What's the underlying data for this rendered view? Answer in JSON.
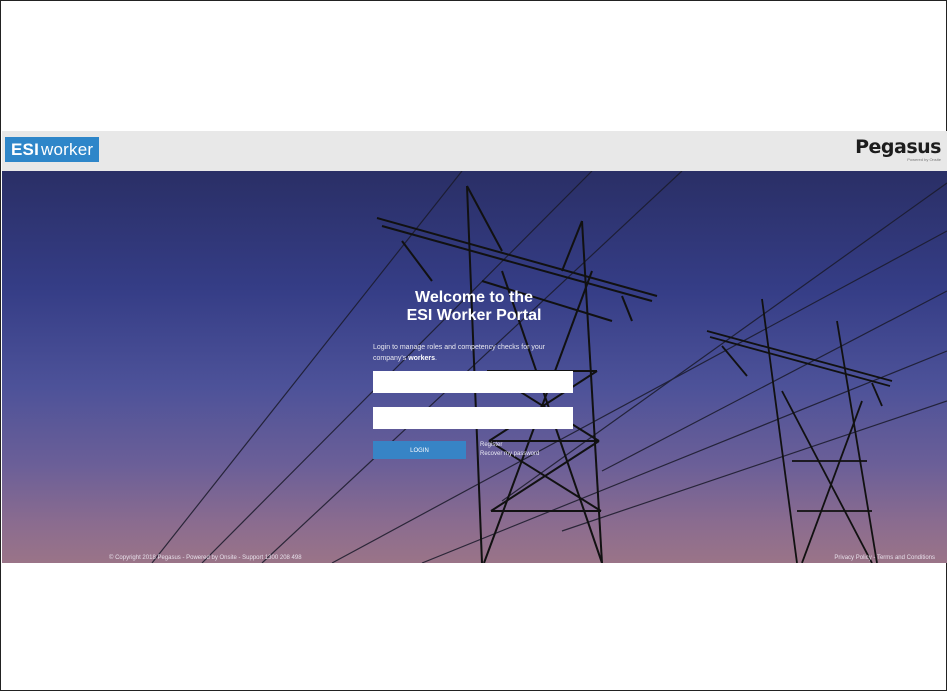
{
  "header": {
    "brand_bold": "ESI",
    "brand_light": "worker",
    "partner_name": "Pegasus",
    "partner_sub": "Powered by Onsite"
  },
  "login": {
    "title_line1": "Welcome to the",
    "title_line2": "ESI Worker Portal",
    "subtitle_part1": "Login to manage roles and competency checks for your company's ",
    "subtitle_bold": "workers",
    "subtitle_end": ".",
    "username_value": "",
    "password_value": "",
    "login_label": "LOGIN",
    "register_label": "Register",
    "recover_label": "Recover my password"
  },
  "footer": {
    "copyright": "© Copyright 2018 Pegasus - Powered by Onsite - Support 1300 208 498",
    "privacy": "Privacy Policy",
    "separator": " - ",
    "terms": "Terms and Conditions"
  },
  "colors": {
    "brand_blue": "#2e86c9",
    "button_blue": "#3784c6",
    "header_bg": "#e8e8e8",
    "sky_top": "#2a2f66",
    "sky_bottom": "#9a7488"
  }
}
